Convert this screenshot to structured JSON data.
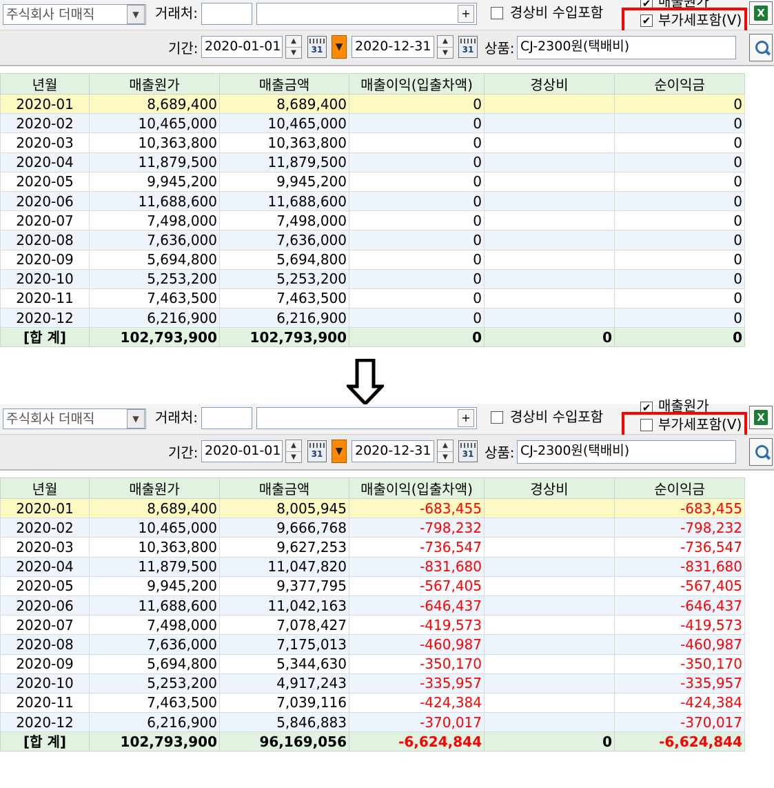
{
  "toolbar": {
    "company": "주식회사 더매직",
    "client_label": "거래처:",
    "client_code": "",
    "client_name": "",
    "plus": "+",
    "expense_label": "경상비 수입포함",
    "cost_label": "매출원가",
    "vat_label": "부가세포함(V)",
    "period_label": "기간:",
    "date_from": "2020-01-01",
    "date_to": "2020-12-31",
    "calendar_day": "31",
    "product_label": "상품:",
    "product_value": "CJ-2300원(택배비)",
    "check_mark": "✔"
  },
  "columns": [
    "년월",
    "매출원가",
    "매출금액",
    "매출이익(입출차액)",
    "경상비",
    "순이익금"
  ],
  "before": {
    "vat_checked": true,
    "rows": [
      [
        "2020-01",
        "8,689,400",
        "8,689,400",
        "0",
        "",
        "0"
      ],
      [
        "2020-02",
        "10,465,000",
        "10,465,000",
        "0",
        "",
        "0"
      ],
      [
        "2020-03",
        "10,363,800",
        "10,363,800",
        "0",
        "",
        "0"
      ],
      [
        "2020-04",
        "11,879,500",
        "11,879,500",
        "0",
        "",
        "0"
      ],
      [
        "2020-05",
        "9,945,200",
        "9,945,200",
        "0",
        "",
        "0"
      ],
      [
        "2020-06",
        "11,688,600",
        "11,688,600",
        "0",
        "",
        "0"
      ],
      [
        "2020-07",
        "7,498,000",
        "7,498,000",
        "0",
        "",
        "0"
      ],
      [
        "2020-08",
        "7,636,000",
        "7,636,000",
        "0",
        "",
        "0"
      ],
      [
        "2020-09",
        "5,694,800",
        "5,694,800",
        "0",
        "",
        "0"
      ],
      [
        "2020-10",
        "5,253,200",
        "5,253,200",
        "0",
        "",
        "0"
      ],
      [
        "2020-11",
        "7,463,500",
        "7,463,500",
        "0",
        "",
        "0"
      ],
      [
        "2020-12",
        "6,216,900",
        "6,216,900",
        "0",
        "",
        "0"
      ]
    ],
    "total": [
      "[합 계]",
      "102,793,900",
      "102,793,900",
      "0",
      "0",
      "0"
    ]
  },
  "after": {
    "vat_checked": false,
    "rows": [
      [
        "2020-01",
        "8,689,400",
        "8,005,945",
        "-683,455",
        "",
        "-683,455"
      ],
      [
        "2020-02",
        "10,465,000",
        "9,666,768",
        "-798,232",
        "",
        "-798,232"
      ],
      [
        "2020-03",
        "10,363,800",
        "9,627,253",
        "-736,547",
        "",
        "-736,547"
      ],
      [
        "2020-04",
        "11,879,500",
        "11,047,820",
        "-831,680",
        "",
        "-831,680"
      ],
      [
        "2020-05",
        "9,945,200",
        "9,377,795",
        "-567,405",
        "",
        "-567,405"
      ],
      [
        "2020-06",
        "11,688,600",
        "11,042,163",
        "-646,437",
        "",
        "-646,437"
      ],
      [
        "2020-07",
        "7,498,000",
        "7,078,427",
        "-419,573",
        "",
        "-419,573"
      ],
      [
        "2020-08",
        "7,636,000",
        "7,175,013",
        "-460,987",
        "",
        "-460,987"
      ],
      [
        "2020-09",
        "5,694,800",
        "5,344,630",
        "-350,170",
        "",
        "-350,170"
      ],
      [
        "2020-10",
        "5,253,200",
        "4,917,243",
        "-335,957",
        "",
        "-335,957"
      ],
      [
        "2020-11",
        "7,463,500",
        "7,039,116",
        "-424,384",
        "",
        "-424,384"
      ],
      [
        "2020-12",
        "6,216,900",
        "5,846,883",
        "-370,017",
        "",
        "-370,017"
      ]
    ],
    "total": [
      "[합 계]",
      "102,793,900",
      "96,169,056",
      "-6,624,844",
      "0",
      "-6,624,844"
    ]
  },
  "colors": {
    "highlight": "#ff0000",
    "negative": "#ff0000",
    "header_bg": "#e1f2e1",
    "selected_row": "#fcfac0",
    "alt_row": "#eef4fb"
  }
}
